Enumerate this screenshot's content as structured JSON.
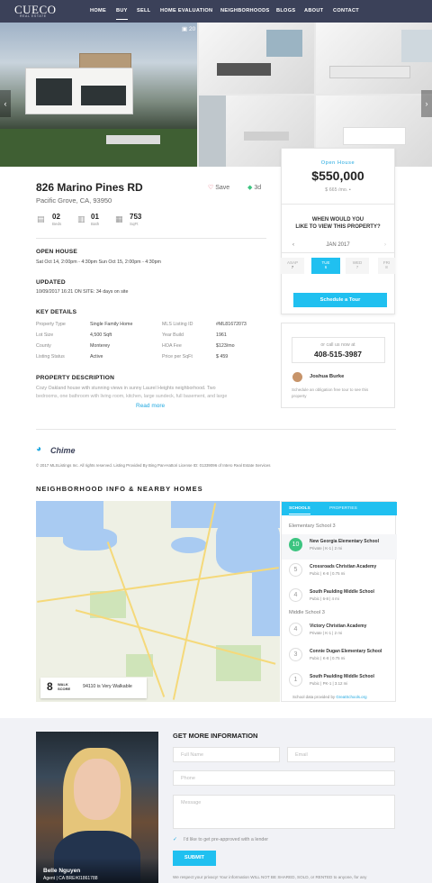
{
  "nav": {
    "logo": "CUECO",
    "logo_sub": "REAL ESTATE",
    "items": [
      "HOME",
      "BUY",
      "SELL",
      "HOME EVALUATION",
      "NEIGHBORHOODS",
      "BLOGS",
      "ABOUT",
      "CONTACT"
    ],
    "active": "BUY"
  },
  "gallery": {
    "photo_count": "20"
  },
  "property": {
    "title": "826 Marino Pines RD",
    "city": "Pacific Grove, CA, 93950",
    "save_label": "Save",
    "tour3d_label": "3d",
    "beds": "02",
    "beds_label": "Beds",
    "baths": "01",
    "baths_label": "Bath",
    "sqft": "753",
    "sqft_label": "SqFt"
  },
  "open_house": {
    "heading": "OPEN HOUSE",
    "text": "Sat Oct 14, 2:00pm - 4:30pm Sun Oct 15, 2:00pm - 4:30pm"
  },
  "updated": {
    "heading": "UPDATED",
    "text": "10/09/2017 16:21 ON SITE: 34 days on site"
  },
  "key_details": {
    "heading": "KEY DETAILS",
    "left": [
      {
        "label": "Property Type",
        "value": "Single Family Home"
      },
      {
        "label": "Lot Size",
        "value": "4,500 Sqft"
      },
      {
        "label": "County",
        "value": "Monterey"
      },
      {
        "label": "Listing Status",
        "value": "Active"
      }
    ],
    "right": [
      {
        "label": "MLS Listing ID",
        "value": "#ML81672073"
      },
      {
        "label": "Year Build",
        "value": "1961"
      },
      {
        "label": "HOA Fee",
        "value": "$123/mo"
      },
      {
        "label": "Price per SqFt",
        "value": "$ 459"
      }
    ]
  },
  "description": {
    "heading": "PROPERTY DESCRIPTION",
    "text1": "Cozy Oakland house with stunning views in sunny Laurel Heights neighborhood. Two",
    "text2": "bedrooms, one bathroom with living room, kitchen, large sundeck, full basement, and large",
    "read_more": "Read more"
  },
  "price_card": {
    "badge": "Open House",
    "price": "$550,000",
    "monthly": "$ 665 /mo.",
    "question1": "WHEN WOULD YOU",
    "question2": "LIKE TO VIEW THIS PROPERTY?",
    "month": "JAN 2017",
    "days": [
      {
        "top": "ASAP",
        "bottom": "7"
      },
      {
        "top": "TUE",
        "bottom": "6"
      },
      {
        "top": "WED",
        "bottom": "7"
      },
      {
        "top": "FRI",
        "bottom": "8"
      }
    ],
    "schedule_label": "Schedule a Tour"
  },
  "agent_card": {
    "call_label": "or call us now at",
    "phone": "408-515-3987",
    "agent_name": "Joshua Burke",
    "note1": "Schedule an obligation free tour to see this",
    "note2": "property"
  },
  "brand": {
    "name": "Chime",
    "copyright": "© 2017 MLSListings Inc. All rights reserved. Listing Provided By Bing Pan-Hattori License ID: 01339096 of Intero Real Estate Services"
  },
  "neighborhood": {
    "heading": "NEIGHBORHOOD INFO & NEARBY HOMES",
    "walk_score": "8",
    "walk_label1": "WALK",
    "walk_label2": "SCORE",
    "walk_text": "94110 is Very Walkable",
    "tabs": [
      "SCHOOLS",
      "PROPERTIES"
    ],
    "elementary_heading": "Elementary School 3",
    "middle_heading": "Middle School 3",
    "schools": [
      {
        "score": "10",
        "name": "New Georgia Elementary School",
        "meta": "Private | K-1 | 2 mi"
      },
      {
        "score": "5",
        "name": "Crossroads Christian Academy",
        "meta": "Pubic | K-8 | 0.75 mi"
      },
      {
        "score": "4",
        "name": "South Paulding Middle School",
        "meta": "Pubic | 6-8 | 4 mi"
      }
    ],
    "middle": [
      {
        "score": "4",
        "name": "Victory Christian Academy",
        "meta": "Private | K-1 | 2 mi"
      },
      {
        "score": "3",
        "name": "Connie Dugan Elementary School",
        "meta": "Pubic | K-8 | 0.75 mi"
      },
      {
        "score": "1",
        "name": "South Paulding Middle School",
        "meta": "Pubic | PK-1 | 3.12 mi"
      }
    ],
    "provided_by": "School data provided by",
    "provider": "GreatSchools.org"
  },
  "contact": {
    "heading": "GET MORE INFORMATION",
    "fullname_ph": "Full Name",
    "email_ph": "Email",
    "phone_ph": "Phone",
    "message_ph": "Message",
    "preapproved_label": "I'd like to get pre-approved with a lender",
    "submit_label": "SUBMIT",
    "privacy": "We respect your privacy! Your information WILL NOT BE SHARED, SOLD, or RENTED to anyone, for any",
    "agent_name": "Belle Nguyen",
    "agent_sub": "Agent | CA BRE#01861788"
  },
  "colors": {
    "nav_bg": "#3b4159",
    "accent": "#20c0f0",
    "walk_green": "#3cc480"
  }
}
